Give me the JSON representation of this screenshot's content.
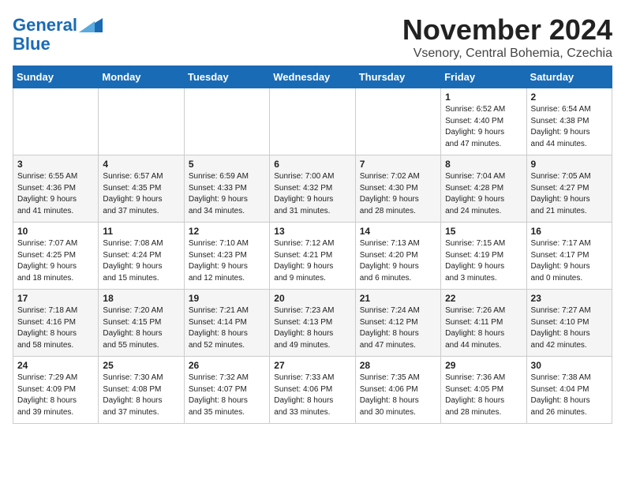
{
  "header": {
    "logo_line1": "General",
    "logo_line2": "Blue",
    "month_title": "November 2024",
    "subtitle": "Vsenory, Central Bohemia, Czechia"
  },
  "days_of_week": [
    "Sunday",
    "Monday",
    "Tuesday",
    "Wednesday",
    "Thursday",
    "Friday",
    "Saturday"
  ],
  "weeks": [
    [
      {
        "day": "",
        "info": ""
      },
      {
        "day": "",
        "info": ""
      },
      {
        "day": "",
        "info": ""
      },
      {
        "day": "",
        "info": ""
      },
      {
        "day": "",
        "info": ""
      },
      {
        "day": "1",
        "info": "Sunrise: 6:52 AM\nSunset: 4:40 PM\nDaylight: 9 hours\nand 47 minutes."
      },
      {
        "day": "2",
        "info": "Sunrise: 6:54 AM\nSunset: 4:38 PM\nDaylight: 9 hours\nand 44 minutes."
      }
    ],
    [
      {
        "day": "3",
        "info": "Sunrise: 6:55 AM\nSunset: 4:36 PM\nDaylight: 9 hours\nand 41 minutes."
      },
      {
        "day": "4",
        "info": "Sunrise: 6:57 AM\nSunset: 4:35 PM\nDaylight: 9 hours\nand 37 minutes."
      },
      {
        "day": "5",
        "info": "Sunrise: 6:59 AM\nSunset: 4:33 PM\nDaylight: 9 hours\nand 34 minutes."
      },
      {
        "day": "6",
        "info": "Sunrise: 7:00 AM\nSunset: 4:32 PM\nDaylight: 9 hours\nand 31 minutes."
      },
      {
        "day": "7",
        "info": "Sunrise: 7:02 AM\nSunset: 4:30 PM\nDaylight: 9 hours\nand 28 minutes."
      },
      {
        "day": "8",
        "info": "Sunrise: 7:04 AM\nSunset: 4:28 PM\nDaylight: 9 hours\nand 24 minutes."
      },
      {
        "day": "9",
        "info": "Sunrise: 7:05 AM\nSunset: 4:27 PM\nDaylight: 9 hours\nand 21 minutes."
      }
    ],
    [
      {
        "day": "10",
        "info": "Sunrise: 7:07 AM\nSunset: 4:25 PM\nDaylight: 9 hours\nand 18 minutes."
      },
      {
        "day": "11",
        "info": "Sunrise: 7:08 AM\nSunset: 4:24 PM\nDaylight: 9 hours\nand 15 minutes."
      },
      {
        "day": "12",
        "info": "Sunrise: 7:10 AM\nSunset: 4:23 PM\nDaylight: 9 hours\nand 12 minutes."
      },
      {
        "day": "13",
        "info": "Sunrise: 7:12 AM\nSunset: 4:21 PM\nDaylight: 9 hours\nand 9 minutes."
      },
      {
        "day": "14",
        "info": "Sunrise: 7:13 AM\nSunset: 4:20 PM\nDaylight: 9 hours\nand 6 minutes."
      },
      {
        "day": "15",
        "info": "Sunrise: 7:15 AM\nSunset: 4:19 PM\nDaylight: 9 hours\nand 3 minutes."
      },
      {
        "day": "16",
        "info": "Sunrise: 7:17 AM\nSunset: 4:17 PM\nDaylight: 9 hours\nand 0 minutes."
      }
    ],
    [
      {
        "day": "17",
        "info": "Sunrise: 7:18 AM\nSunset: 4:16 PM\nDaylight: 8 hours\nand 58 minutes."
      },
      {
        "day": "18",
        "info": "Sunrise: 7:20 AM\nSunset: 4:15 PM\nDaylight: 8 hours\nand 55 minutes."
      },
      {
        "day": "19",
        "info": "Sunrise: 7:21 AM\nSunset: 4:14 PM\nDaylight: 8 hours\nand 52 minutes."
      },
      {
        "day": "20",
        "info": "Sunrise: 7:23 AM\nSunset: 4:13 PM\nDaylight: 8 hours\nand 49 minutes."
      },
      {
        "day": "21",
        "info": "Sunrise: 7:24 AM\nSunset: 4:12 PM\nDaylight: 8 hours\nand 47 minutes."
      },
      {
        "day": "22",
        "info": "Sunrise: 7:26 AM\nSunset: 4:11 PM\nDaylight: 8 hours\nand 44 minutes."
      },
      {
        "day": "23",
        "info": "Sunrise: 7:27 AM\nSunset: 4:10 PM\nDaylight: 8 hours\nand 42 minutes."
      }
    ],
    [
      {
        "day": "24",
        "info": "Sunrise: 7:29 AM\nSunset: 4:09 PM\nDaylight: 8 hours\nand 39 minutes."
      },
      {
        "day": "25",
        "info": "Sunrise: 7:30 AM\nSunset: 4:08 PM\nDaylight: 8 hours\nand 37 minutes."
      },
      {
        "day": "26",
        "info": "Sunrise: 7:32 AM\nSunset: 4:07 PM\nDaylight: 8 hours\nand 35 minutes."
      },
      {
        "day": "27",
        "info": "Sunrise: 7:33 AM\nSunset: 4:06 PM\nDaylight: 8 hours\nand 33 minutes."
      },
      {
        "day": "28",
        "info": "Sunrise: 7:35 AM\nSunset: 4:06 PM\nDaylight: 8 hours\nand 30 minutes."
      },
      {
        "day": "29",
        "info": "Sunrise: 7:36 AM\nSunset: 4:05 PM\nDaylight: 8 hours\nand 28 minutes."
      },
      {
        "day": "30",
        "info": "Sunrise: 7:38 AM\nSunset: 4:04 PM\nDaylight: 8 hours\nand 26 minutes."
      }
    ]
  ]
}
